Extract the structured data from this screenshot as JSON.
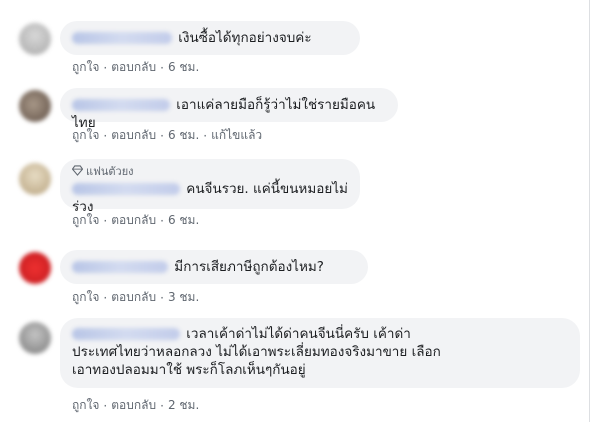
{
  "comments": [
    {
      "avatar_color": "#bfbfbf",
      "text": "เงินซื้อได้ทุกอย่างจบค่ะ",
      "actions": [
        "ถูกใจ",
        "ตอบกลับ",
        "6 ชม."
      ]
    },
    {
      "avatar_color": "#8a7a6e",
      "text": "เอาแค่ลายมือก็รู้ว่าไม่ใช่รายมือคนไทย",
      "actions": [
        "ถูกใจ",
        "ตอบกลับ",
        "6 ชม.",
        "แก้ไขแล้ว"
      ]
    },
    {
      "avatar_color": "#c9b99a",
      "badge": "แฟนตัวยง",
      "text": "คนจีนรวย. แค่นี้ขนหมอยไม่ร่วง",
      "actions": [
        "ถูกใจ",
        "ตอบกลับ",
        "6 ชม."
      ]
    },
    {
      "avatar_color": "#d9262a",
      "text": "มีการเสียภาษีถูกต้องไหม?",
      "actions": [
        "ถูกใจ",
        "ตอบกลับ",
        "3 ชม."
      ]
    },
    {
      "avatar_color": "#9a9a9a",
      "text_lines": [
        "เวลาเค้าด่าไม่ได้ด่าคนจีนนี่ครับ เค้าด่า",
        "ประเทศไทยว่าหลอกลวง ไม่ได้เอาพระเลี่ยมทองจริงมาขาย เลือก",
        "เอาทองปลอมมาใช้ พระก็โลภเห็นๆกันอยู่"
      ],
      "actions": [
        "ถูกใจ",
        "ตอบกลับ",
        "2 ชม."
      ]
    }
  ]
}
